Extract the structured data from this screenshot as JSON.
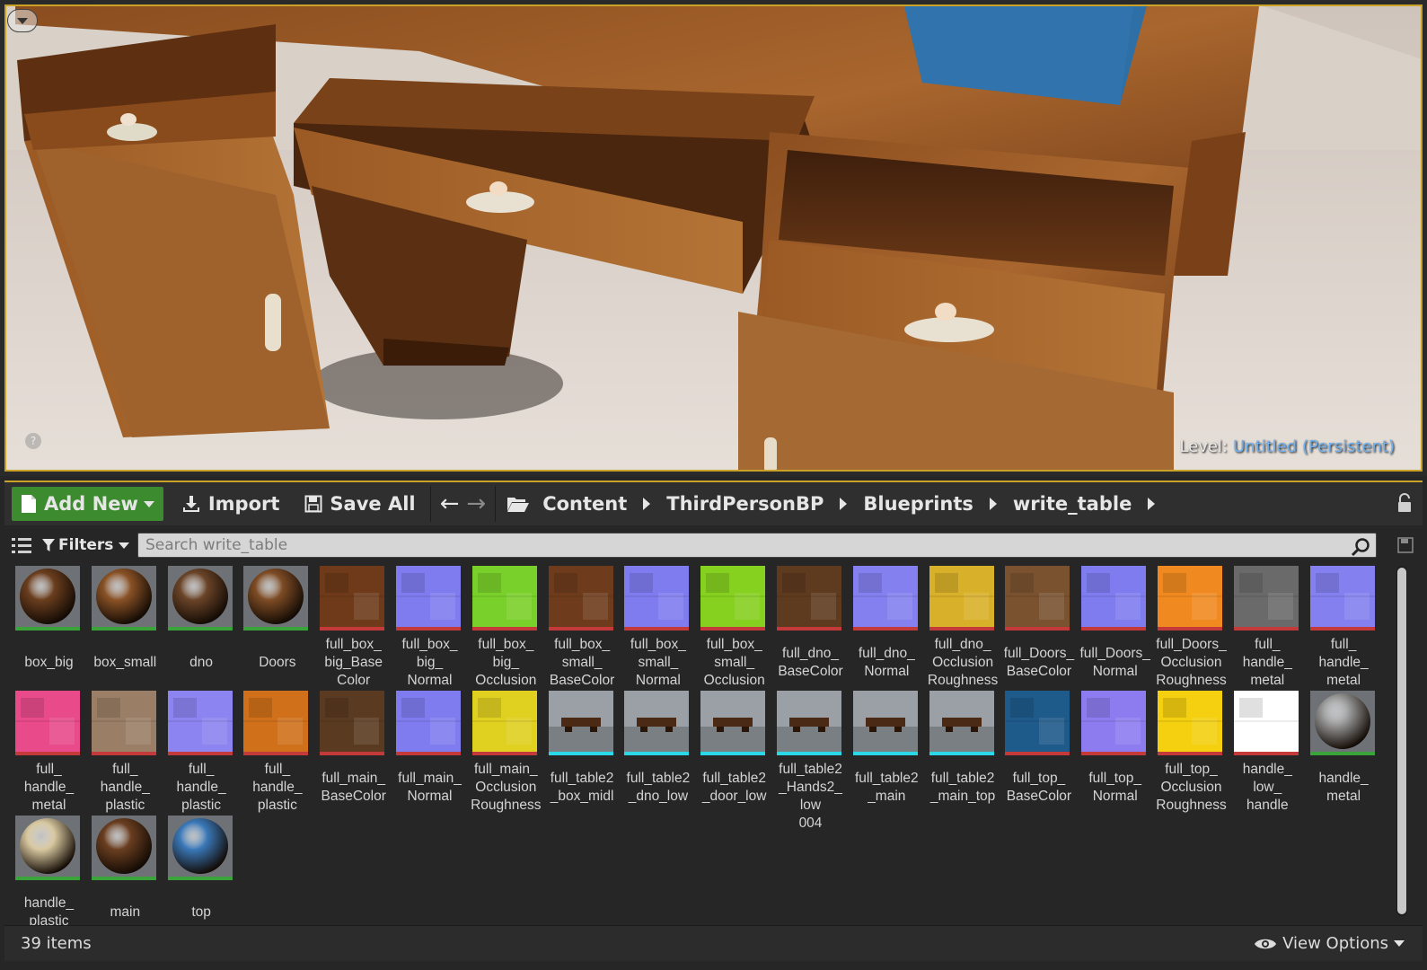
{
  "viewport": {
    "level_label": "Level:",
    "level_name": "Untitled (Persistent)",
    "help_glyph": "?"
  },
  "toolbar": {
    "add_new_label": "Add New",
    "import_label": "Import",
    "save_all_label": "Save All",
    "breadcrumbs": [
      "Content",
      "ThirdPersonBP",
      "Blueprints",
      "write_table"
    ]
  },
  "filterbar": {
    "filters_label": "Filters",
    "search_placeholder": "Search write_table"
  },
  "status": {
    "item_count": "39 items",
    "view_options_label": "View Options"
  },
  "assets": [
    {
      "name": "box_big",
      "type": "material",
      "color": "#6b3e1e",
      "strip": "#3aa33a"
    },
    {
      "name": "box_small",
      "type": "material",
      "color": "#8a5226",
      "strip": "#3aa33a"
    },
    {
      "name": "dno",
      "type": "material",
      "color": "#6a4428",
      "strip": "#3aa33a"
    },
    {
      "name": "Doors",
      "type": "material",
      "color": "#7e4c25",
      "strip": "#3aa33a"
    },
    {
      "name": "full_box_ big_Base Color",
      "type": "texture",
      "color": "#6e3a1a",
      "strip": "#c43a3a"
    },
    {
      "name": "full_box_ big_ Normal",
      "type": "texture",
      "color": "#7f7cf0",
      "strip": "#c43a3a"
    },
    {
      "name": "full_box_ big_ Occlusion",
      "type": "texture",
      "color": "#7ad02a",
      "strip": "#c43a3a"
    },
    {
      "name": "full_box_ small_ BaseColor",
      "type": "texture",
      "color": "#6e3c1c",
      "strip": "#c43a3a"
    },
    {
      "name": "full_box_ small_ Normal",
      "type": "texture",
      "color": "#7f7cf0",
      "strip": "#c43a3a"
    },
    {
      "name": "full_box_ small_ Occlusion",
      "type": "texture",
      "color": "#86d020",
      "strip": "#c43a3a"
    },
    {
      "name": "full_dno_ BaseColor",
      "type": "texture",
      "color": "#5e3a1e",
      "strip": "#c43a3a"
    },
    {
      "name": "full_dno_ Normal",
      "type": "texture",
      "color": "#8480f0",
      "strip": "#c43a3a"
    },
    {
      "name": "full_dno_ Occlusion Roughness",
      "type": "texture",
      "color": "#d8b02a",
      "strip": "#c43a3a"
    },
    {
      "name": "full_Doors_ BaseColor",
      "type": "texture",
      "color": "#7a5230",
      "strip": "#c43a3a"
    },
    {
      "name": "full_Doors_ Normal",
      "type": "texture",
      "color": "#7f7cf0",
      "strip": "#c43a3a"
    },
    {
      "name": "full_Doors_ Occlusion Roughness",
      "type": "texture",
      "color": "#f08a20",
      "strip": "#c43a3a"
    },
    {
      "name": "full_ handle_ metal",
      "type": "texture",
      "color": "#6a6a6a",
      "strip": "#c43a3a"
    },
    {
      "name": "full_ handle_ metal",
      "type": "texture",
      "color": "#8480f0",
      "strip": "#c43a3a"
    },
    {
      "name": "full_ handle_ metal",
      "type": "texture",
      "color": "#e84a8a",
      "strip": "#c43a3a"
    },
    {
      "name": "full_ handle_ plastic",
      "type": "texture",
      "color": "#9a7e66",
      "strip": "#c43a3a"
    },
    {
      "name": "full_ handle_ plastic",
      "type": "texture",
      "color": "#8c84f0",
      "strip": "#c43a3a"
    },
    {
      "name": "full_ handle_ plastic",
      "type": "texture",
      "color": "#d0701a",
      "strip": "#c43a3a"
    },
    {
      "name": "full_main_ BaseColor",
      "type": "texture",
      "color": "#5a3a20",
      "strip": "#c43a3a"
    },
    {
      "name": "full_main_ Normal",
      "type": "texture",
      "color": "#7f7cf0",
      "strip": "#c43a3a"
    },
    {
      "name": "full_main_ Occlusion Roughness",
      "type": "texture",
      "color": "#e0d020",
      "strip": "#c43a3a"
    },
    {
      "name": "full_table2 _box_midl",
      "type": "mesh",
      "color": "#8a8a8a",
      "strip": "#2ad8e8"
    },
    {
      "name": "full_table2 _dno_low",
      "type": "mesh",
      "color": "#8a8a8a",
      "strip": "#2ad8e8"
    },
    {
      "name": "full_table2 _door_low",
      "type": "mesh",
      "color": "#8a8a8a",
      "strip": "#2ad8e8"
    },
    {
      "name": "full_table2 _Hands2_ low 004",
      "type": "mesh",
      "color": "#8a8a8a",
      "strip": "#2ad8e8"
    },
    {
      "name": "full_table2 _main",
      "type": "mesh",
      "color": "#8a8a8a",
      "strip": "#2ad8e8"
    },
    {
      "name": "full_table2 _main_top",
      "type": "mesh",
      "color": "#8a8a8a",
      "strip": "#2ad8e8"
    },
    {
      "name": "full_top_ BaseColor",
      "type": "texture",
      "color": "#1e5a8a",
      "strip": "#c43a3a"
    },
    {
      "name": "full_top_ Normal",
      "type": "texture",
      "color": "#8c7cf0",
      "strip": "#c43a3a"
    },
    {
      "name": "full_top_ Occlusion Roughness",
      "type": "texture",
      "color": "#f4d010",
      "strip": "#c43a3a"
    },
    {
      "name": "handle_ low_ handle",
      "type": "texture",
      "color": "#ffffff",
      "strip": "#c43a3a"
    },
    {
      "name": "handle_ metal",
      "type": "material",
      "color": "#9a9a9a",
      "strip": "#3aa33a"
    },
    {
      "name": "handle_ plastic",
      "type": "material",
      "color": "#d8c8a0",
      "strip": "#3aa33a"
    },
    {
      "name": "main",
      "type": "material",
      "color": "#6a3e20",
      "strip": "#3aa33a"
    },
    {
      "name": "top",
      "type": "material",
      "color": "#3a78b8",
      "strip": "#3aa33a"
    }
  ]
}
